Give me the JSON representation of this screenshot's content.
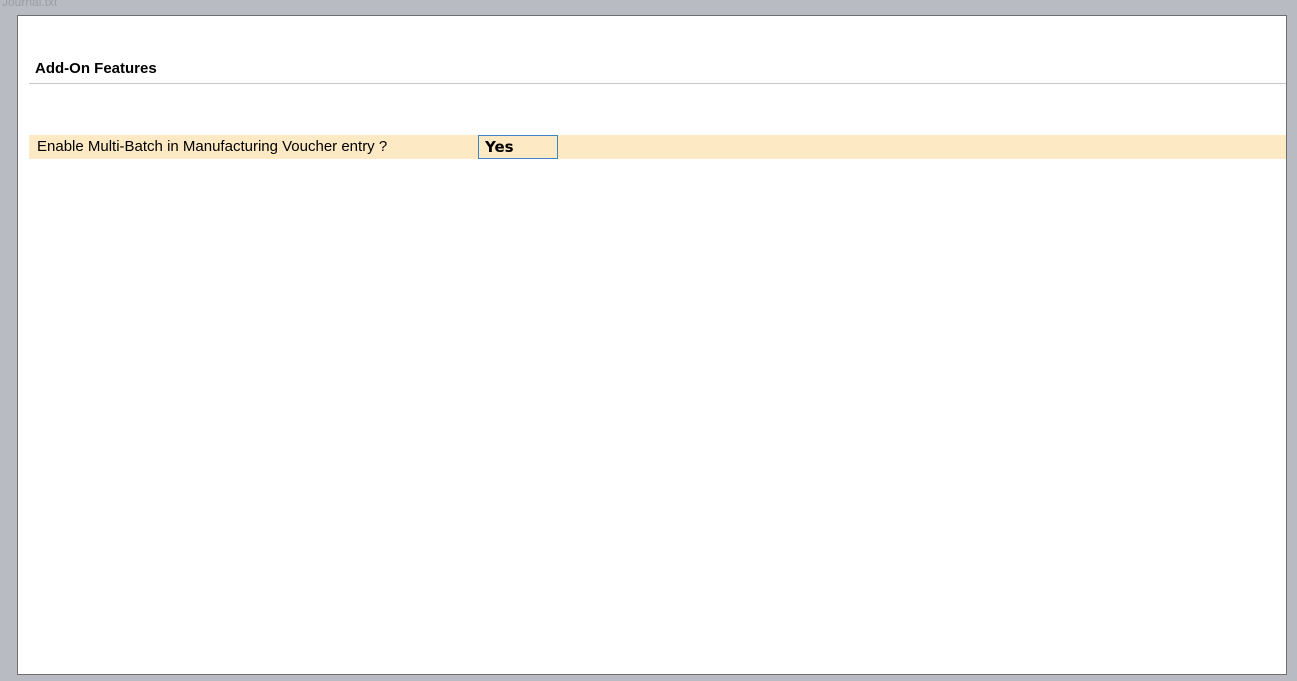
{
  "window": {
    "background_title": "Journal.txt"
  },
  "section": {
    "title": "Add-On Features"
  },
  "option": {
    "label": "Enable Multi-Batch in Manufacturing Voucher entry ?",
    "value": "Yes"
  },
  "colors": {
    "row_highlight": "#fde9c4",
    "focus_border": "#3d86c6",
    "backdrop": "#b8bcc2"
  }
}
